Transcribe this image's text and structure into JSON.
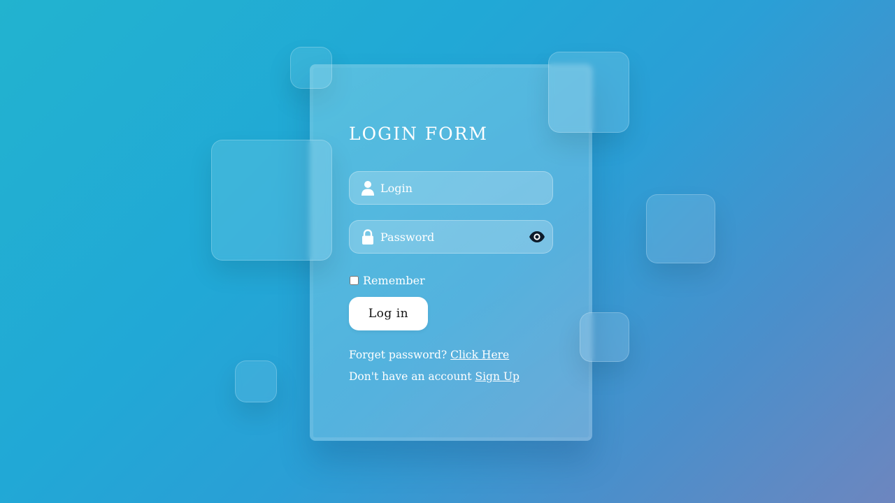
{
  "form": {
    "title": "LOGIN FORM",
    "login_field": {
      "placeholder": "Login",
      "value": "",
      "icon": "user-icon"
    },
    "password_field": {
      "placeholder": "Password",
      "value": "",
      "icon": "lock-icon",
      "toggle_icon": "eye-icon"
    },
    "remember_label": "Remember",
    "remember_checked": false,
    "login_button": "Log in",
    "forgot_text": "Forget password?",
    "forgot_link": "Click Here",
    "signup_text": "Don't have an account",
    "signup_link": "Sign Up"
  },
  "colors": {
    "background_start": "#22b3cf",
    "background_end": "#6d86bf",
    "text": "#ffffff",
    "button_bg": "#ffffff",
    "button_text": "#111111"
  }
}
